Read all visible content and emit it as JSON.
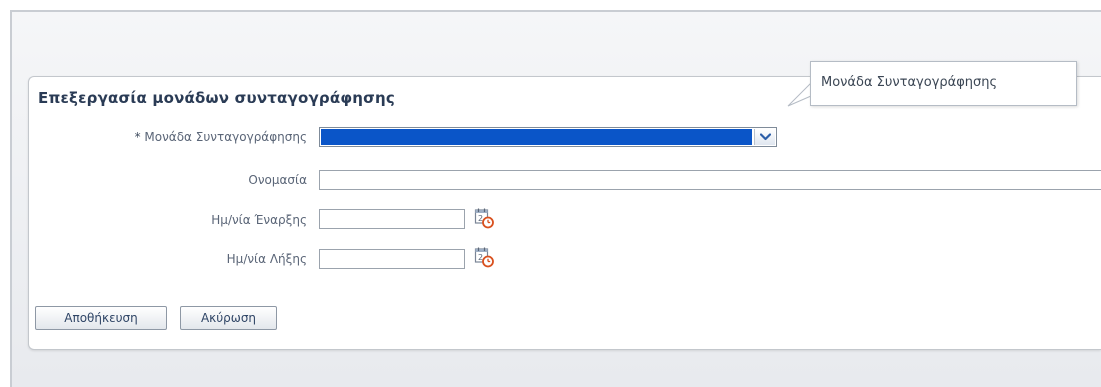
{
  "panel": {
    "title": "Επεξεργασία μονάδων συνταγογράφησης"
  },
  "form": {
    "unit_label": "Μονάδα Συνταγογράφησης",
    "unit_required_mark": "*",
    "unit_selected_value": "",
    "name_label": "Ονομασία",
    "name_value": "",
    "start_date_label": "Ημ/νία Έναρξης",
    "start_date_value": "",
    "end_date_label": "Ημ/νία Λήξης",
    "end_date_value": ""
  },
  "actions": {
    "save_label": "Αποθήκευση",
    "cancel_label": "Ακύρωση"
  },
  "tooltip": {
    "text": "Μονάδα Συνταγογράφησης"
  },
  "colors": {
    "selection_highlight": "#0a55c8",
    "title_text": "#2a3b55"
  },
  "icons": {
    "dropdown": "chevron-down-icon",
    "calendar": "calendar-icon"
  }
}
